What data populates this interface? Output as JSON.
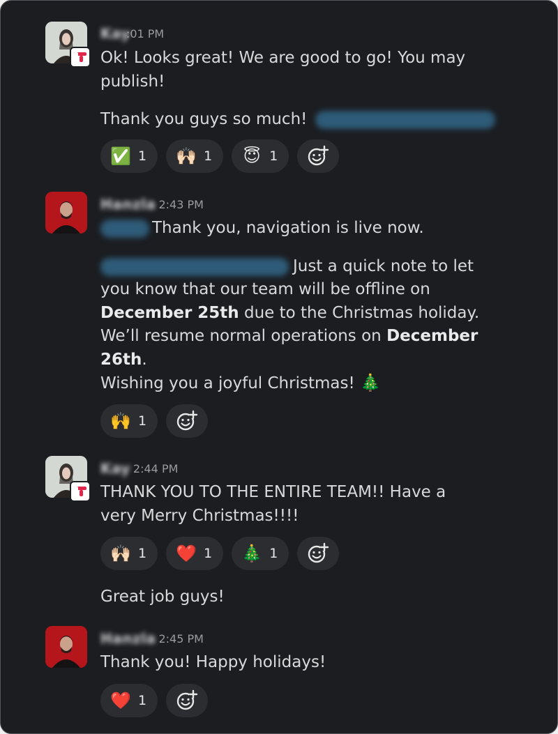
{
  "messages": [
    {
      "author": "Kay",
      "time": "2:01 PM",
      "time_visible": ":01 PM",
      "lines": [
        "Ok! Looks great! We are good to go! You may",
        "publish!",
        "Thank you guys so much!"
      ],
      "reactions": [
        {
          "emoji": "✅",
          "count": "1"
        },
        {
          "emoji": "🙌🏻",
          "count": "1"
        },
        {
          "emoji": "😇",
          "count": "1"
        }
      ]
    },
    {
      "author": "Hanzla",
      "time": "2:43 PM",
      "lines": [
        "Thank you, navigation is live now.",
        "Just a quick note to let",
        "you know that our team will be offline on",
        "due to the Christmas holiday.",
        "We’ll resume normal operations on",
        ".",
        "Wishing you a joyful Christmas!"
      ],
      "bold": [
        "December 25th",
        "December",
        "26th"
      ],
      "reactions": [
        {
          "emoji": "🙌",
          "count": "1"
        }
      ]
    },
    {
      "author": "Kay",
      "time": "2:44 PM",
      "lines": [
        "THANK YOU TO THE ENTIRE TEAM!! Have a",
        "very Merry Christmas!!!!",
        "Great job guys!"
      ],
      "reactions": [
        {
          "emoji": "🙌🏻",
          "count": "1"
        },
        {
          "emoji": "❤️",
          "count": "1"
        },
        {
          "emoji": "🎄",
          "count": "1"
        }
      ]
    },
    {
      "author": "Hanzla",
      "time": "2:45 PM",
      "lines": [
        "Thank you! Happy holidays!"
      ],
      "reactions": [
        {
          "emoji": "❤️",
          "count": "1"
        }
      ]
    }
  ],
  "icons": {
    "add_reaction": "add-reaction-icon",
    "app_badge": "app-badge-icon",
    "tree": "christmas-tree-icon"
  },
  "colors": {
    "background": "#1b1d21",
    "pill": "#2b2d31",
    "text": "#d8d9da",
    "timestamp": "#9a9b9e",
    "badge_accent": "#e0264b"
  }
}
